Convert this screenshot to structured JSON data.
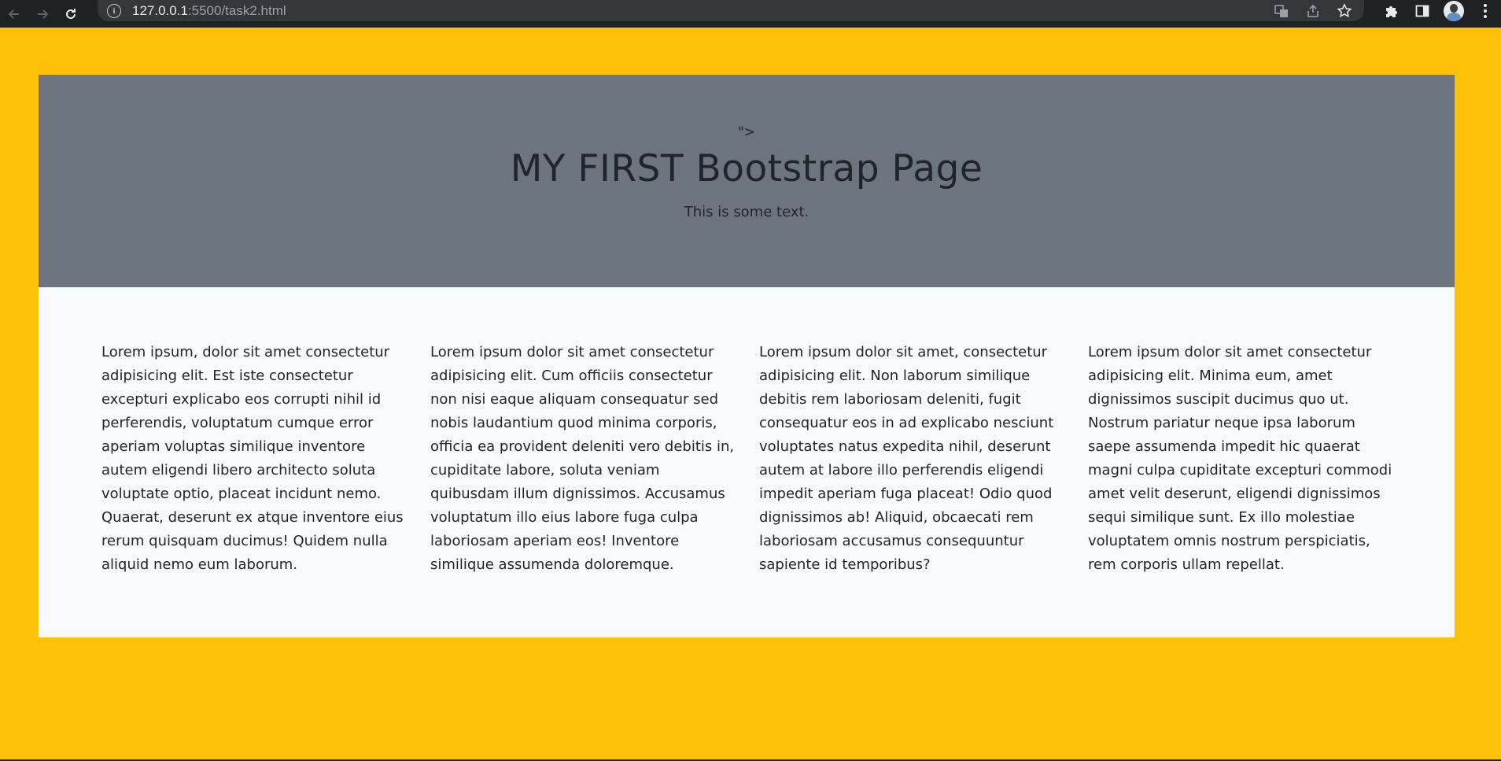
{
  "browser": {
    "url_host": "127.0.0.1",
    "url_rest": ":5500/task2.html",
    "back_icon": "arrow-left-icon",
    "forward_icon": "arrow-right-icon",
    "reload_icon": "reload-icon",
    "info_icon": "info-icon",
    "translate_icon": "translate-icon",
    "share_icon": "share-icon",
    "bookmark_icon": "star-icon",
    "extensions_icon": "puzzle-icon",
    "sidepanel_icon": "side-panel-icon",
    "profile_icon": "avatar",
    "menu_icon": "kebab-menu-icon"
  },
  "hero": {
    "stray_text": "\">",
    "title": "MY FIRST Bootstrap Page",
    "text": "This is some text."
  },
  "columns": [
    {
      "text": "Lorem ipsum, dolor sit amet consectetur adipisicing elit. Est iste consectetur excepturi explicabo eos corrupti nihil id perferendis, voluptatum cumque error aperiam voluptas similique inventore autem eligendi libero architecto soluta voluptate optio, placeat incidunt nemo. Quaerat, deserunt ex atque inventore eius rerum quisquam ducimus! Quidem nulla aliquid nemo eum laborum."
    },
    {
      "text": "Lorem ipsum dolor sit amet consectetur adipisicing elit. Cum officiis consectetur non nisi eaque aliquam consequatur sed nobis laudantium quod minima corporis, officia ea provident deleniti vero debitis in, cupiditate labore, soluta veniam quibusdam illum dignissimos. Accusamus voluptatum illo eius labore fuga culpa laboriosam aperiam eos! Inventore similique assumenda doloremque."
    },
    {
      "text": "Lorem ipsum dolor sit amet, consectetur adipisicing elit. Non laborum similique debitis rem laboriosam deleniti, fugit consequatur eos in ad explicabo nesciunt voluptates natus expedita nihil, deserunt autem at labore illo perferendis eligendi impedit aperiam fuga placeat! Odio quod dignissimos ab! Aliquid, obcaecati rem laboriosam accusamus consequuntur sapiente id temporibus?"
    },
    {
      "text": "Lorem ipsum dolor sit amet consectetur adipisicing elit. Minima eum, amet dignissimos suscipit ducimus quo ut. Nostrum pariatur neque ipsa laborum saepe assumenda impedit hic quaerat magni culpa cupiditate excepturi commodi amet velit deserunt, eligendi dignissimos sequi similique sunt. Ex illo molestiae voluptatem omnis nostrum perspiciatis, rem corporis ullam repellat."
    }
  ],
  "colors": {
    "page_background": "#ffc107",
    "hero_background": "#6c757d",
    "content_background": "#f8f9fa",
    "text": "#212529",
    "browser_bar": "#202124"
  }
}
